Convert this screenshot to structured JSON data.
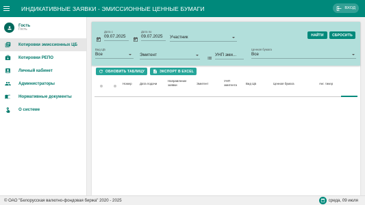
{
  "header": {
    "title": "ИНДИКАТИВНЫЕ ЗАЯВКИ - ЭМИССИОННЫЕ ЦЕННЫЕ БУМАГИ",
    "login_label": "ВХОД"
  },
  "user": {
    "name": "Гость",
    "role": "Гость"
  },
  "sidebar": {
    "items": [
      {
        "label": "Котировки эмиссионных ЦБ",
        "icon": "library-icon"
      },
      {
        "label": "Котировки РЕПО",
        "icon": "repo-icon"
      },
      {
        "label": "Личный кабинет",
        "icon": "profile-card-icon"
      },
      {
        "label": "Администраторы",
        "icon": "people-icon"
      },
      {
        "label": "Нормативные документы",
        "icon": "book-icon"
      },
      {
        "label": "О системе",
        "icon": "touch-icon"
      }
    ]
  },
  "filters": {
    "date_from": {
      "label": "Дата с",
      "value": "09.07.2025"
    },
    "date_to": {
      "label": "Дата по",
      "value": "09.07.2025"
    },
    "participant": {
      "value": "Участник"
    },
    "security_type": {
      "label": "Вид ЦБ",
      "value": "Все"
    },
    "issuer": {
      "value": "Эмитент"
    },
    "unp": {
      "value": "УНП эми..."
    },
    "security": {
      "label": "Ценная бумага",
      "value": "Все"
    },
    "find_label": "НАЙТИ",
    "reset_label": "СБРОСИТЬ"
  },
  "toolbar": {
    "refresh_label": "ОБНОВИТЬ ТАБЛИЦУ",
    "export_label": "ЭКСПОРТ В EXCEL"
  },
  "table": {
    "columns": [
      "Номер",
      "Дата подачи",
      "Направление заявки",
      "Эмитент",
      "УНП эмитента",
      "Вид ЦБ",
      "Ценная бумага",
      "Анг. тикер"
    ]
  },
  "footer": {
    "copyright": "© ОАО \"Белорусская валютно-фондовая биржа\" 2020 - 2025",
    "date": "среда, 09 июля"
  },
  "colors": {
    "primary": "#00897b",
    "filter_bg": "#b2dfdb"
  }
}
